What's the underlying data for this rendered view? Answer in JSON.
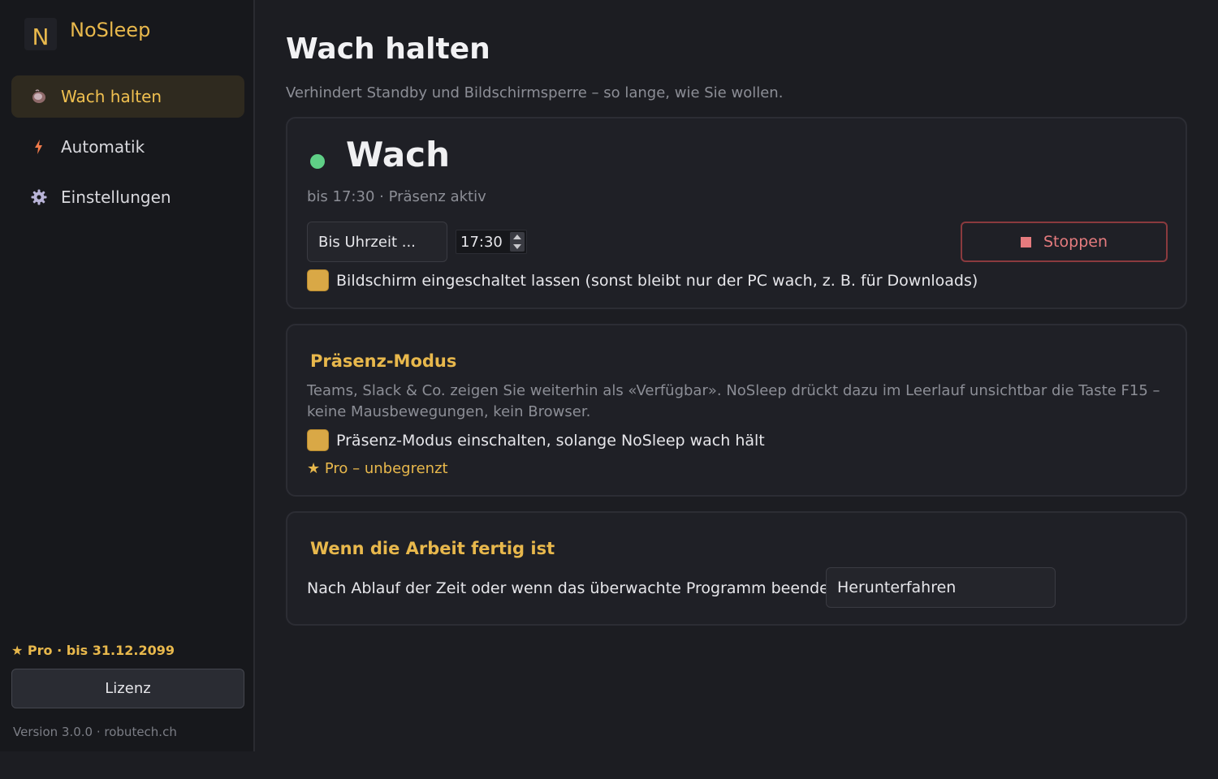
{
  "app": {
    "name": "NoSleep",
    "logo_letter": "N"
  },
  "colors": {
    "accent": "#e8b84c",
    "status_active": "#5fcf86",
    "stop": "#e57b7e",
    "background": "#1c1d22",
    "sidebar": "#17181c"
  },
  "sidebar": {
    "items": [
      {
        "label": "Wach halten",
        "icon": "coffee-cup-icon",
        "active": true
      },
      {
        "label": "Automatik",
        "icon": "lightning-bolt-icon",
        "active": false
      },
      {
        "label": "Einstellungen",
        "icon": "gear-icon",
        "active": false
      }
    ],
    "pro_badge": "★ Pro · bis 31.12.2099",
    "license_button": "Lizenz",
    "version": "Version 3.0.0 · robutech.ch"
  },
  "main": {
    "title": "Wach halten",
    "subtitle": "Verhindert Standby und Bildschirmsperre – so lange, wie Sie wollen.",
    "status": {
      "title": "Wach",
      "detail": "bis 17:30 · Präsenz aktiv",
      "mode_select": "Bis Uhrzeit ...",
      "time_value": "17:30",
      "stop_button": "Stoppen",
      "screen_on_label": "Bildschirm eingeschaltet lassen (sonst bleibt nur der PC wach, z. B. für Downloads)",
      "screen_on_checked": true
    },
    "presence": {
      "title": "Präsenz-Modus",
      "description": "Teams, Slack & Co. zeigen Sie weiterhin als «Verfügbar». NoSleep drückt dazu im Leerlauf unsichtbar die Taste F15 – keine Mausbewegungen, kein Browser.",
      "enable_label": "Präsenz-Modus einschalten, solange NoSleep wach hält",
      "enable_checked": true,
      "pro_line": "★ Pro – unbegrenzt"
    },
    "after_work": {
      "title": "Wenn die Arbeit fertig ist",
      "label": "Nach Ablauf der Zeit oder wenn das überwachte Programm beendet ist:",
      "action_select": "Herunterfahren"
    }
  }
}
